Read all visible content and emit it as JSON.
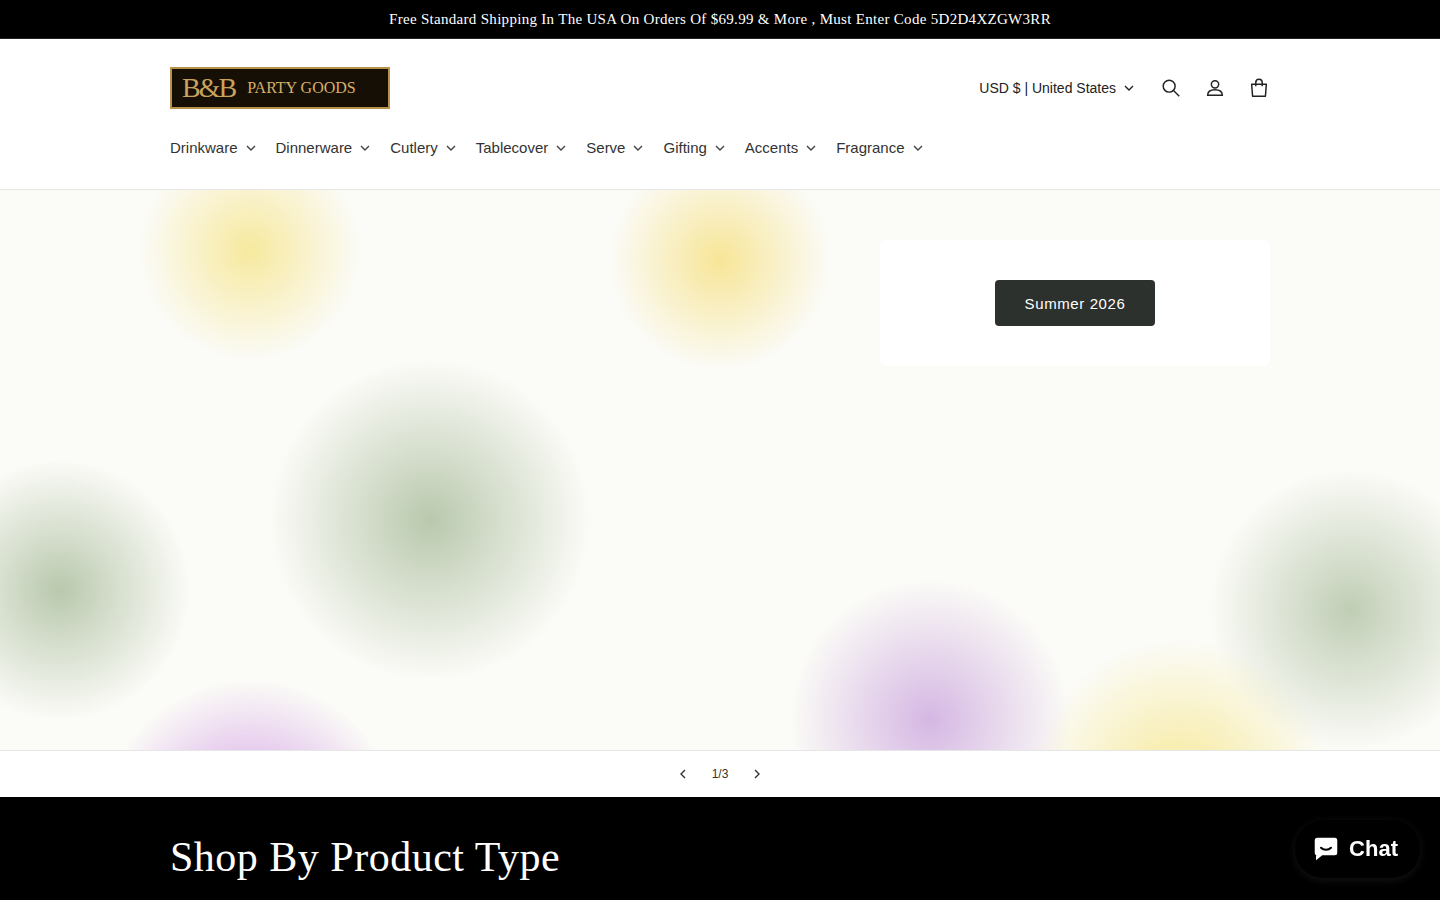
{
  "announcement": "Free Standard Shipping In The USA On Orders Of $69.99 & More , Must Enter Code 5D2D4XZGW3RR",
  "logo": {
    "mark": "B&B",
    "name": "PARTY GOODS"
  },
  "locale": "USD $ | United States",
  "nav": [
    "Drinkware",
    "Dinnerware",
    "Cutlery",
    "Tablecover",
    "Serve",
    "Gifting",
    "Accents",
    "Fragrance"
  ],
  "hero": {
    "button": "Summer 2026"
  },
  "slider": {
    "counter": "1/3"
  },
  "section": {
    "title": "Shop By Product Type"
  },
  "chat": {
    "label": "Chat"
  }
}
